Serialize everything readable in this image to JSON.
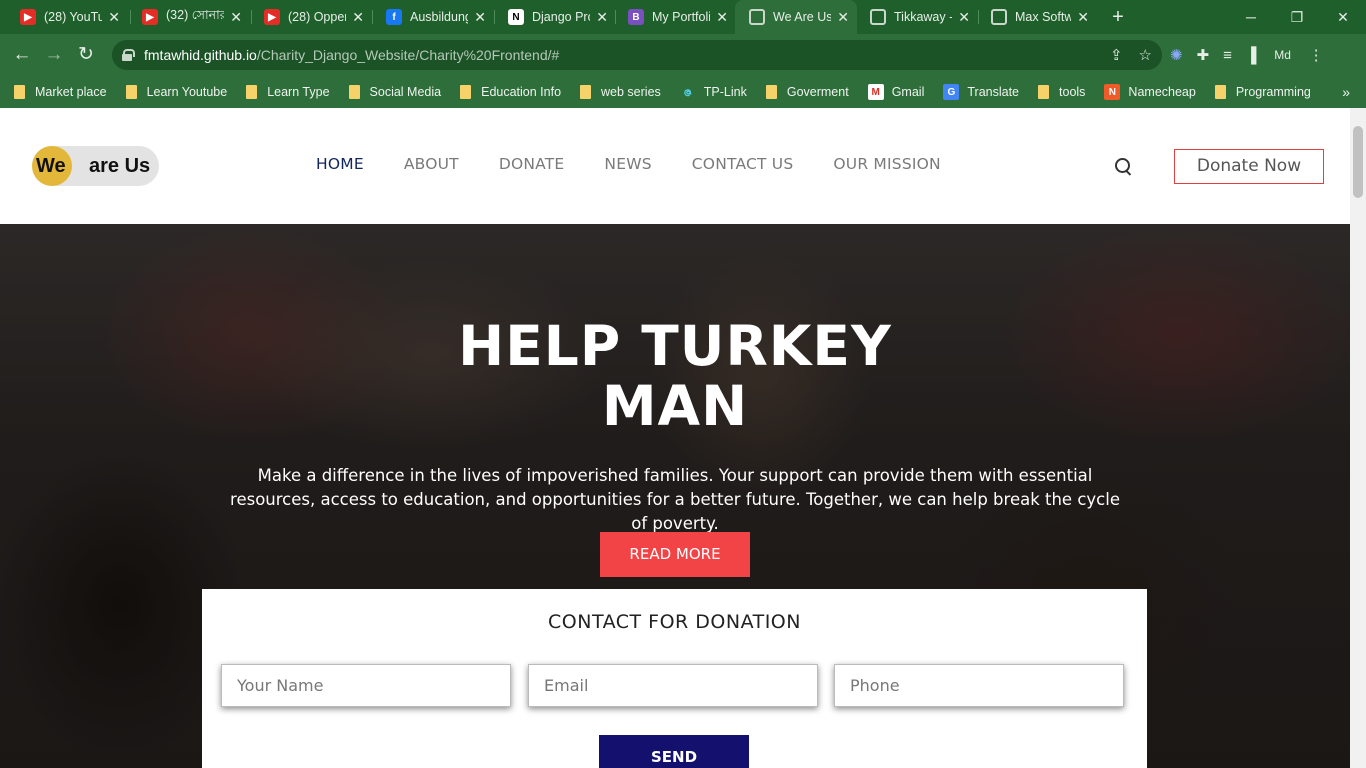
{
  "browser": {
    "tabs": [
      {
        "title": "(28) YouTu",
        "icon": "youtube-icon"
      },
      {
        "title": "(32) সোনার",
        "icon": "youtube-icon"
      },
      {
        "title": "(28) Opper",
        "icon": "youtube-icon"
      },
      {
        "title": "Ausbildung",
        "icon": "facebook-icon"
      },
      {
        "title": "Django Pro",
        "icon": "notion-icon"
      },
      {
        "title": "My Portfoli",
        "icon": "bootstrap-icon"
      },
      {
        "title": "We Are Us",
        "icon": "globe-icon"
      },
      {
        "title": "Tikkaway -",
        "icon": "globe-icon"
      },
      {
        "title": "Max Softw",
        "icon": "globe-icon"
      }
    ],
    "url_host": "fmtawhid.github.io",
    "url_path": "/Charity_Django_Website/Charity%20Frontend/#",
    "profile_label": "Md",
    "bookmarks": [
      {
        "label": "Market place",
        "icon": "folder-icon"
      },
      {
        "label": "Learn Youtube",
        "icon": "folder-icon"
      },
      {
        "label": "Learn Type",
        "icon": "folder-icon"
      },
      {
        "label": "Social Media",
        "icon": "folder-icon"
      },
      {
        "label": "Education Info",
        "icon": "folder-icon"
      },
      {
        "label": "web series",
        "icon": "folder-icon"
      },
      {
        "label": "TP-Link",
        "icon": "tplink-icon"
      },
      {
        "label": "Goverment",
        "icon": "folder-icon"
      },
      {
        "label": "Gmail",
        "icon": "gmail-icon"
      },
      {
        "label": "Translate",
        "icon": "translate-icon"
      },
      {
        "label": "tools",
        "icon": "folder-icon"
      },
      {
        "label": "Namecheap",
        "icon": "namecheap-icon"
      },
      {
        "label": "Programming",
        "icon": "folder-icon"
      }
    ]
  },
  "site": {
    "logo": {
      "part1": "We",
      "part2": "are Us"
    },
    "nav": [
      "HOME",
      "ABOUT",
      "DONATE",
      "NEWS",
      "CONTACT US",
      "OUR MISSION"
    ],
    "donate_now": "Donate Now",
    "hero": {
      "title_line1": "HELP TURKEY",
      "title_line2": "MAN",
      "text": "Make a difference in the lives of impoverished families. Your support can provide them with essential resources, access to education, and opportunities for a better future. Together, we can help break the cycle of poverty.",
      "cta": "READ MORE"
    },
    "contact": {
      "title": "CONTACT FOR DONATION",
      "name_placeholder": "Your Name",
      "email_placeholder": "Email",
      "phone_placeholder": "Phone",
      "send": "SEND"
    }
  },
  "colors": {
    "chrome_green": "#2e6e3a",
    "accent_red": "#f24446",
    "send_navy": "#14106e",
    "logo_gold": "#e3b83a",
    "nav_active": "#12245c"
  }
}
